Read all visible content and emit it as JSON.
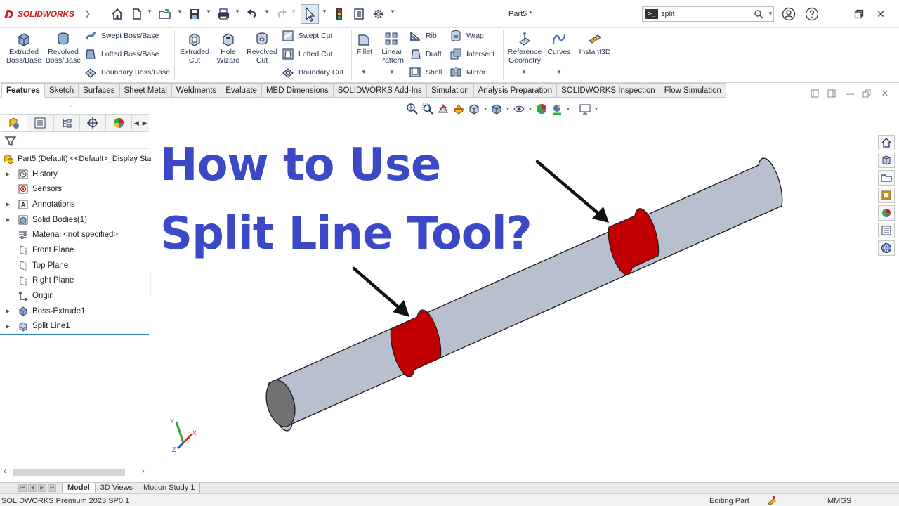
{
  "app": {
    "brand": "SOLIDWORKS",
    "document_title": "Part5 *"
  },
  "search": {
    "value": "split",
    "prompt_glyph": ">_"
  },
  "ribbon": {
    "extruded_boss": "Extruded Boss/Base",
    "revolved_boss": "Revolved Boss/Base",
    "swept_boss": "Swept Boss/Base",
    "lofted_boss": "Lofted Boss/Base",
    "boundary_boss": "Boundary Boss/Base",
    "extruded_cut": "Extruded Cut",
    "hole_wizard": "Hole Wizard",
    "revolved_cut": "Revolved Cut",
    "swept_cut": "Swept Cut",
    "lofted_cut": "Lofted Cut",
    "boundary_cut": "Boundary Cut",
    "fillet": "Fillet",
    "linear_pattern": "Linear Pattern",
    "rib": "Rib",
    "draft": "Draft",
    "shell": "Shell",
    "wrap": "Wrap",
    "intersect": "Intersect",
    "mirror": "Mirror",
    "reference_geometry": "Reference Geometry",
    "curves": "Curves",
    "instant3d": "Instant3D"
  },
  "tabs": [
    "Features",
    "Sketch",
    "Surfaces",
    "Sheet Metal",
    "Weldments",
    "Evaluate",
    "MBD Dimensions",
    "SOLIDWORKS Add-Ins",
    "Simulation",
    "Analysis Preparation",
    "SOLIDWORKS Inspection",
    "Flow Simulation"
  ],
  "tree": {
    "root": "Part5 (Default) <<Default>_Display Sta",
    "items": {
      "history": "History",
      "sensors": "Sensors",
      "annotations": "Annotations",
      "solid_bodies": "Solid Bodies(1)",
      "material": "Material <not specified>",
      "front_plane": "Front Plane",
      "top_plane": "Top Plane",
      "right_plane": "Right Plane",
      "origin": "Origin",
      "boss_extrude": "Boss-Extrude1",
      "split_line": "Split Line1"
    }
  },
  "overlay": {
    "line1": "How to Use",
    "line2": "Split Line Tool?",
    "color": "#3c49c6"
  },
  "model": {
    "body_color": "#d6dbe6",
    "split_face_color": "#ee0000"
  },
  "bottom_tabs": [
    "Model",
    "3D Views",
    "Motion Study 1"
  ],
  "status": {
    "product": "SOLIDWORKS Premium 2023 SP0.1",
    "mode": "Editing Part",
    "units": "MMGS"
  }
}
